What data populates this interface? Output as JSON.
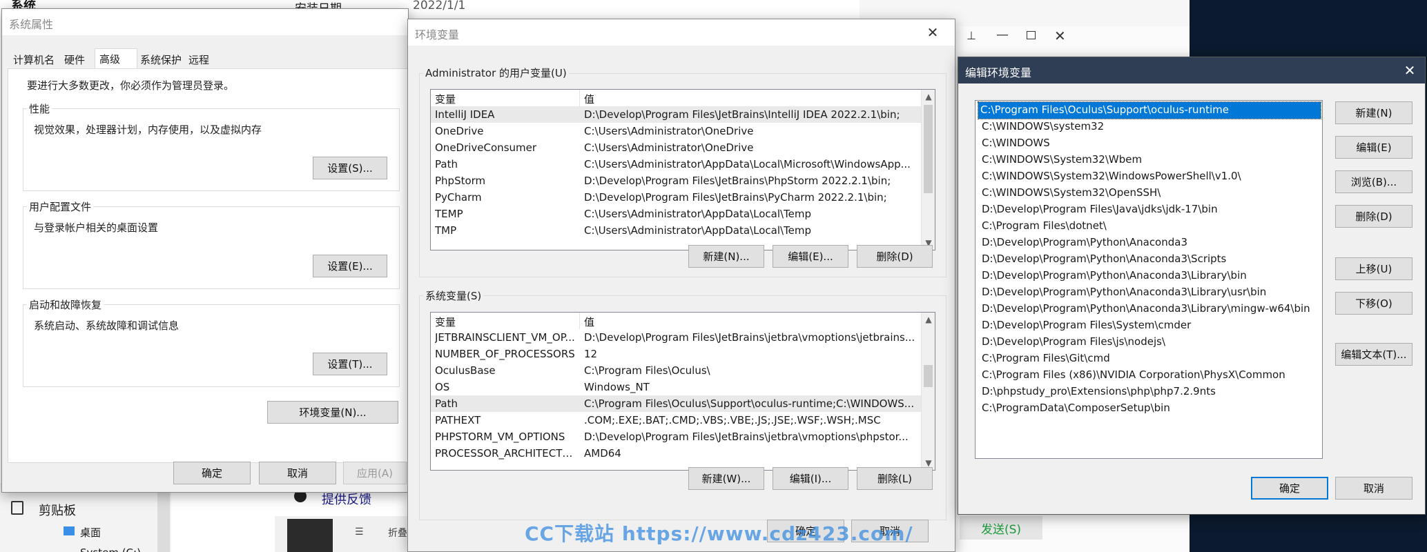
{
  "background_explorer": {
    "title_partial": "系统",
    "install_date_label": "安装日期",
    "install_date_value": "2022/1/1",
    "clipboard": "剪贴板",
    "desktop": "桌面",
    "drive_partial": "System (C:)",
    "feedback": "提供反馈",
    "fold": "折叠",
    "send_button": "发送(S)"
  },
  "sys_props": {
    "title": "系统属性",
    "tabs": [
      "计算机名",
      "硬件",
      "高级",
      "系统保护",
      "远程"
    ],
    "admin_note": "要进行大多数更改，你必须作为管理员登录。",
    "perf": {
      "label": "性能",
      "desc": "视觉效果，处理器计划，内存使用，以及虚拟内存",
      "button": "设置(S)..."
    },
    "profile": {
      "label": "用户配置文件",
      "desc": "与登录帐户相关的桌面设置",
      "button": "设置(E)..."
    },
    "startup": {
      "label": "启动和故障恢复",
      "desc": "系统启动、系统故障和调试信息",
      "button": "设置(T)..."
    },
    "env_button": "环境变量(N)...",
    "ok": "确定",
    "cancel": "取消",
    "apply": "应用(A)"
  },
  "env_vars": {
    "title": "环境变量",
    "user_group": "Administrator 的用户变量(U)",
    "sys_group": "系统变量(S)",
    "col_var": "变量",
    "col_val": "值",
    "user_rows": [
      {
        "name": "IntelliJ IDEA",
        "value": "D:\\Develop\\Program Files\\JetBrains\\IntelliJ IDEA 2022.2.1\\bin;"
      },
      {
        "name": "OneDrive",
        "value": "C:\\Users\\Administrator\\OneDrive"
      },
      {
        "name": "OneDriveConsumer",
        "value": "C:\\Users\\Administrator\\OneDrive"
      },
      {
        "name": "Path",
        "value": "C:\\Users\\Administrator\\AppData\\Local\\Microsoft\\WindowsApp..."
      },
      {
        "name": "PhpStorm",
        "value": "D:\\Develop\\Program Files\\JetBrains\\PhpStorm 2022.2.1\\bin;"
      },
      {
        "name": "PyCharm",
        "value": "D:\\Develop\\Program Files\\JetBrains\\PyCharm 2022.2.1\\bin;"
      },
      {
        "name": "TEMP",
        "value": "C:\\Users\\Administrator\\AppData\\Local\\Temp"
      },
      {
        "name": "TMP",
        "value": "C:\\Users\\Administrator\\AppData\\Local\\Temp"
      }
    ],
    "sys_rows": [
      {
        "name": "JETBRAINSCLIENT_VM_OP...",
        "value": "D:\\Develop\\Program Files\\JetBrains\\jetbra\\vmoptions\\jetbrains..."
      },
      {
        "name": "NUMBER_OF_PROCESSORS",
        "value": "12"
      },
      {
        "name": "OculusBase",
        "value": "C:\\Program Files\\Oculus\\"
      },
      {
        "name": "OS",
        "value": "Windows_NT"
      },
      {
        "name": "Path",
        "value": "C:\\Program Files\\Oculus\\Support\\oculus-runtime;C:\\WINDOWS..."
      },
      {
        "name": "PATHEXT",
        "value": ".COM;.EXE;.BAT;.CMD;.VBS;.VBE;.JS;.JSE;.WSF;.WSH;.MSC"
      },
      {
        "name": "PHPSTORM_VM_OPTIONS",
        "value": "D:\\Develop\\Program Files\\JetBrains\\jetbra\\vmoptions\\phpstor..."
      },
      {
        "name": "PROCESSOR_ARCHITECTURE",
        "value": "AMD64"
      }
    ],
    "user_buttons": [
      "新建(N)...",
      "编辑(E)...",
      "删除(D)"
    ],
    "sys_buttons": [
      "新建(W)...",
      "编辑(I)...",
      "删除(L)"
    ],
    "ok": "确定",
    "cancel": "取消"
  },
  "edit_env": {
    "title": "编辑环境变量",
    "paths": [
      "C:\\Program Files\\Oculus\\Support\\oculus-runtime",
      "C:\\WINDOWS\\system32",
      "C:\\WINDOWS",
      "C:\\WINDOWS\\System32\\Wbem",
      "C:\\WINDOWS\\System32\\WindowsPowerShell\\v1.0\\",
      "C:\\WINDOWS\\System32\\OpenSSH\\",
      "D:\\Develop\\Program Files\\Java\\jdks\\jdk-17\\bin",
      "C:\\Program Files\\dotnet\\",
      "D:\\Develop\\Program\\Python\\Anaconda3",
      "D:\\Develop\\Program\\Python\\Anaconda3\\Scripts",
      "D:\\Develop\\Program\\Python\\Anaconda3\\Library\\bin",
      "D:\\Develop\\Program\\Python\\Anaconda3\\Library\\usr\\bin",
      "D:\\Develop\\Program\\Python\\Anaconda3\\Library\\mingw-w64\\bin",
      "D:\\Develop\\Program Files\\System\\cmder",
      "D:\\Develop\\Program Files\\js\\nodejs\\",
      "C:\\Program Files\\Git\\cmd",
      "C:\\Program Files (x86)\\NVIDIA Corporation\\PhysX\\Common",
      "D:\\phpstudy_pro\\Extensions\\php\\php7.2.9nts",
      "C:\\ProgramData\\ComposerSetup\\bin"
    ],
    "buttons": [
      "新建(N)",
      "编辑(E)",
      "浏览(B)...",
      "删除(D)",
      "上移(U)",
      "下移(O)",
      "编辑文本(T)..."
    ],
    "ok": "确定",
    "cancel": "取消"
  },
  "watermark": "CC下载站 https://www.cdz423.com/"
}
